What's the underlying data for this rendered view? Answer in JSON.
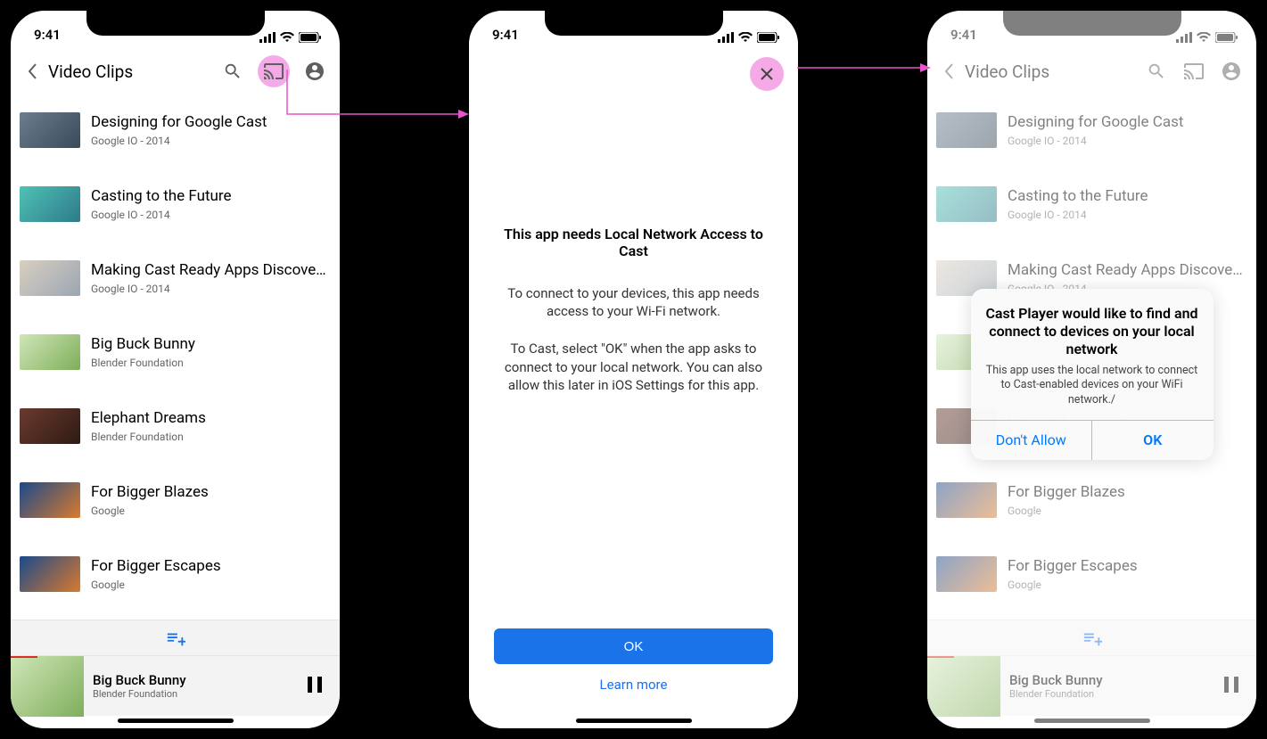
{
  "status": {
    "time": "9:41"
  },
  "nav": {
    "title": "Video Clips"
  },
  "videos": [
    {
      "title": "Designing for Google Cast",
      "sub": "Google IO - 2014",
      "thumb": "linear-gradient(135deg,#6b7d8e,#3a4a5a)"
    },
    {
      "title": "Casting to the Future",
      "sub": "Google IO - 2014",
      "thumb": "linear-gradient(135deg,#4fc2b5,#2e7a8a)"
    },
    {
      "title": "Making Cast Ready Apps Discoverable",
      "sub": "Google IO - 2014",
      "thumb": "linear-gradient(135deg,#d9cfc1,#9aa6b2)"
    },
    {
      "title": "Big Buck Bunny",
      "sub": "Blender Foundation",
      "thumb": "linear-gradient(135deg,#cfe6b8,#7fae5a)"
    },
    {
      "title": "Elephant Dreams",
      "sub": "Blender Foundation",
      "thumb": "linear-gradient(135deg,#6b3a2e,#2e1a14)"
    },
    {
      "title": "For Bigger Blazes",
      "sub": "Google",
      "thumb": "linear-gradient(135deg,#1a4a8a,#d97a2e)"
    },
    {
      "title": "For Bigger Escapes",
      "sub": "Google",
      "thumb": "linear-gradient(135deg,#1a4a8a,#d97a2e)"
    }
  ],
  "nowplaying": {
    "title": "Big Buck Bunny",
    "sub": "Blender Foundation",
    "progress_pct": 8
  },
  "info": {
    "headline": "This app needs Local Network Access to Cast",
    "p1": "To connect to your devices, this app needs access to your Wi-Fi network.",
    "p2": "To Cast, select \"OK\" when the app asks to connect to your local network. You can also allow this later in iOS Settings for this app.",
    "ok": "OK",
    "learn": "Learn more"
  },
  "dialog": {
    "title": "Cast Player would like to find and connect to devices on your local network",
    "msg": "This app uses the local network to connect to Cast-enabled devices on your WiFi network./",
    "deny": "Don't Allow",
    "allow": "OK"
  }
}
